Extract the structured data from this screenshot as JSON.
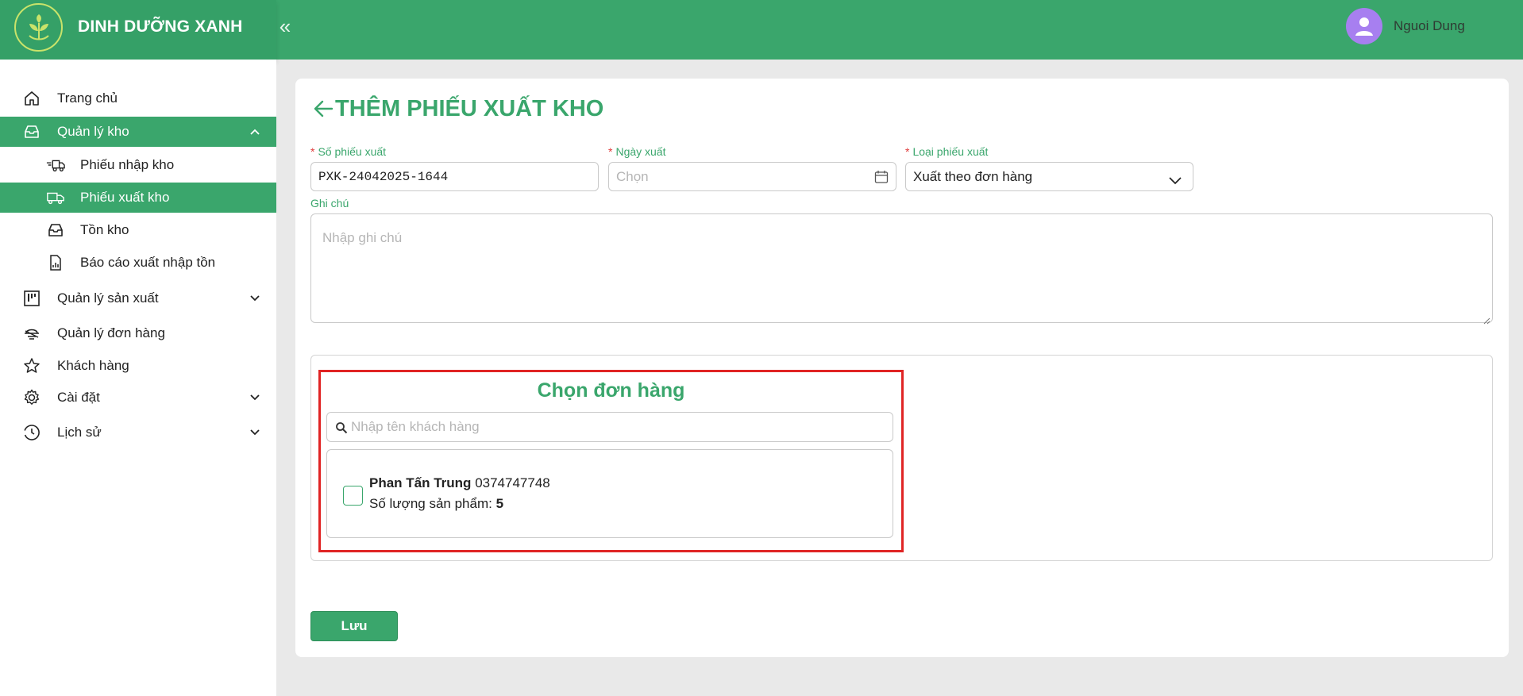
{
  "app": {
    "brand_name": "DINH DƯỠNG XANH",
    "collapse_glyph": "«",
    "user_name": "Nguoi Dung",
    "accent_color": "#3aa66c"
  },
  "sidebar": {
    "items": [
      {
        "label": "Trang chủ",
        "icon": "home-icon"
      },
      {
        "label": "Quản lý kho",
        "icon": "inbox-icon",
        "expanded": true,
        "active": true
      },
      {
        "label": "Phiếu nhập kho",
        "icon": "truck-in-icon"
      },
      {
        "label": "Phiếu xuất kho",
        "icon": "truck-out-icon",
        "selected": true
      },
      {
        "label": "Tồn kho",
        "icon": "inbox-icon"
      },
      {
        "label": "Báo cáo xuất nhập tồn",
        "icon": "report-icon"
      },
      {
        "label": "Quản lý sản xuất",
        "icon": "board-icon",
        "expandable": true
      },
      {
        "label": "Quản lý đơn hàng",
        "icon": "order-icon"
      },
      {
        "label": "Khách hàng",
        "icon": "star-icon"
      },
      {
        "label": "Cài đặt",
        "icon": "gear-icon",
        "expandable": true
      },
      {
        "label": "Lịch sử",
        "icon": "history-icon",
        "expandable": true
      }
    ]
  },
  "page": {
    "title": "THÊM PHIẾU XUẤT KHO",
    "fields": {
      "receipt_no": {
        "label": "Số phiếu xuất",
        "value": "PXK-24042025-1644"
      },
      "export_date": {
        "label": "Ngày xuất",
        "placeholder": "Chọn"
      },
      "export_type": {
        "label": "Loại phiếu xuất",
        "value": "Xuất theo đơn hàng"
      },
      "note": {
        "label": "Ghi chú",
        "placeholder": "Nhập ghi chú"
      }
    },
    "required_mark": "*",
    "order_picker": {
      "title": "Chọn đơn hàng",
      "search_placeholder": "Nhập tên khách hàng",
      "orders": [
        {
          "customer": "Phan Tấn Trung",
          "phone": "0374747748",
          "qty_label": "Số lượng sản phẩm:",
          "qty": "5",
          "checked": false
        }
      ]
    },
    "save_label": "Lưu"
  }
}
